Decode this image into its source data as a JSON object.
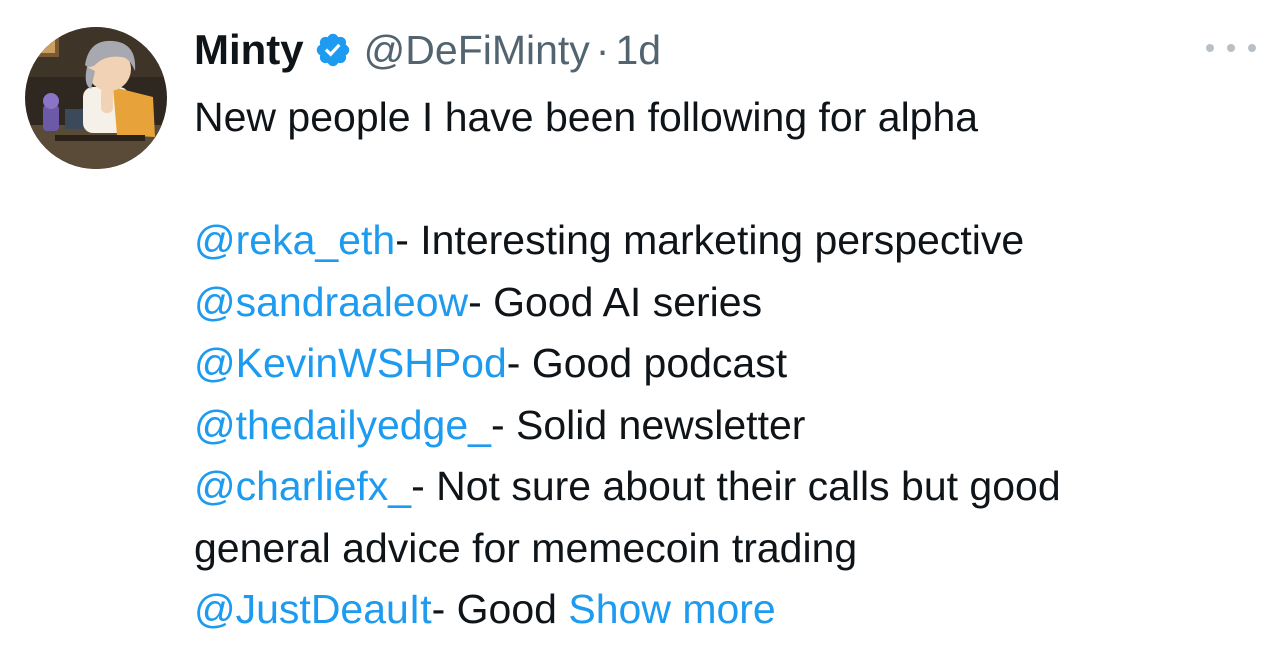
{
  "author": {
    "display_name": "Minty",
    "handle": "@DeFiMinty",
    "separator": "·",
    "timestamp": "1d",
    "verified_icon": "verified-badge-icon",
    "avatar_icon": "avatar-illustration"
  },
  "menu": {
    "icon": "more-options-icon"
  },
  "tweet": {
    "intro": "New people I have been following for alpha",
    "entries": [
      {
        "mention": "@reka_eth",
        "text": "- Interesting marketing perspective"
      },
      {
        "mention": "@sandraaleow",
        "text": "- Good AI series"
      },
      {
        "mention": "@KevinWSHPod",
        "text": "- Good podcast"
      },
      {
        "mention": "@thedailyedge_",
        "text": "- Solid newsletter"
      },
      {
        "mention": "@charliefx_",
        "text": "- Not sure about their calls but good"
      },
      {
        "mention": "@JustDeauIt",
        "text": "- Good"
      }
    ],
    "continuation": "general advice for memecoin trading",
    "show_more": "Show more"
  },
  "colors": {
    "link": "#1d9bf0",
    "text": "#0f1419",
    "secondary": "#536471",
    "verified": "#1d9bf0"
  }
}
